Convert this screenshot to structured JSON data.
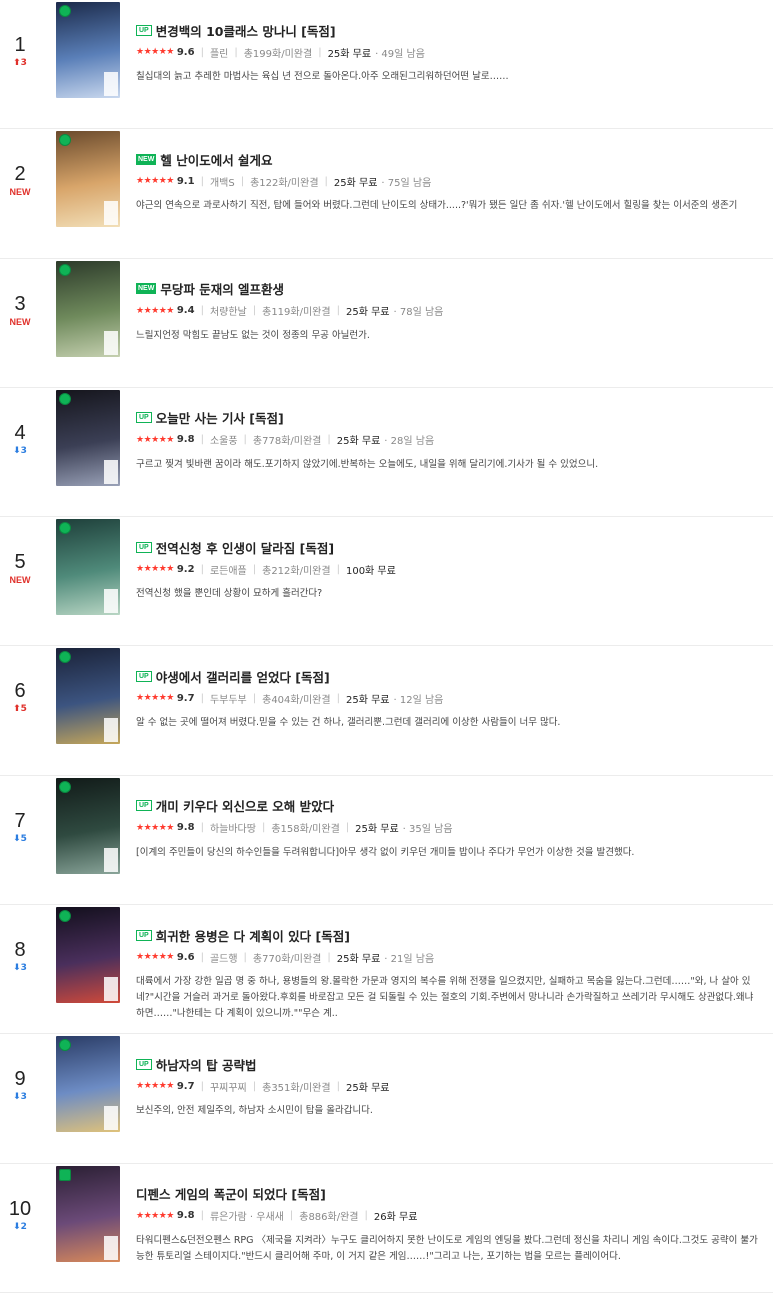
{
  "items": [
    {
      "rank": "1",
      "change": {
        "dir": "up",
        "arrow": "⬆",
        "value": "3"
      },
      "tag": "UP",
      "title": "변경백의 10클래스 망나니 [독점]",
      "stars": "★★★★★",
      "score": "9.6",
      "author": "플린",
      "episodes": "총199화/미완결",
      "free": "25화 무료",
      "days": "· 49일 남음",
      "desc": "칠십대의 늙고 추레한 마법사는 육십 년 전으로 돌아온다.아주 오래된그리워하던어떤 날로……",
      "cover": {
        "title": "",
        "colors": [
          "#1b2a4a",
          "#5a7fb8",
          "#c9d8ee"
        ]
      }
    },
    {
      "rank": "2",
      "change": {
        "dir": "new",
        "arrow": "",
        "value": "NEW"
      },
      "tag": "NEW",
      "title": "헬 난이도에서 쉴게요",
      "stars": "★★★★★",
      "score": "9.1",
      "author": "개백S",
      "episodes": "총122화/미완결",
      "free": "25화 무료",
      "days": "· 75일 남음",
      "desc": "야근의 연속으로 과로사하기 직전, 탑에 들어와 버렸다.그런데 난이도의 상태가.....?'뭐가 됐든 일단 좀 쉬자.'헬 난이도에서 힐링을 찾는 이서준의 생존기",
      "cover": {
        "title": "",
        "colors": [
          "#6a4a2c",
          "#d8a56a",
          "#f2dfb8"
        ]
      }
    },
    {
      "rank": "3",
      "change": {
        "dir": "new",
        "arrow": "",
        "value": "NEW"
      },
      "tag": "NEW",
      "title": "무당파 둔재의 엘프환생",
      "stars": "★★★★★",
      "score": "9.4",
      "author": "처량한날",
      "episodes": "총119화/미완결",
      "free": "25화 무료",
      "days": "· 78일 남음",
      "desc": "느릴지언정 막힘도 끝남도 없는 것이 정종의 무공 아닐런가.",
      "cover": {
        "title": "",
        "colors": [
          "#2c3a2a",
          "#6f8a5c",
          "#c5d0b0"
        ]
      }
    },
    {
      "rank": "4",
      "change": {
        "dir": "down",
        "arrow": "⬇",
        "value": "3"
      },
      "tag": "UP",
      "title": "오늘만 사는 기사 [독점]",
      "stars": "★★★★★",
      "score": "9.8",
      "author": "소울풍",
      "episodes": "총778화/미완결",
      "free": "25화 무료",
      "days": "· 28일 남음",
      "desc": "구르고 찢겨 빛바랜 꿈이라 해도.포기하지 않았기에.반복하는 오늘에도, 내일을 위해 달리기에.기사가 될 수 있었으니.",
      "cover": {
        "title": "",
        "colors": [
          "#15151c",
          "#3b3f55",
          "#9aa2b8"
        ]
      }
    },
    {
      "rank": "5",
      "change": {
        "dir": "new",
        "arrow": "",
        "value": "NEW"
      },
      "tag": "UP",
      "title": "전역신청 후 인생이 달라짐 [독점]",
      "stars": "★★★★★",
      "score": "9.2",
      "author": "로든애플",
      "episodes": "총212화/미완결",
      "free": "100화 무료",
      "days": "",
      "desc": "전역신청 했을 뿐인데 상황이 묘하게 흘러간다?",
      "cover": {
        "title": "",
        "colors": [
          "#1e3f3a",
          "#4f8a7a",
          "#b9d6c4"
        ]
      }
    },
    {
      "rank": "6",
      "change": {
        "dir": "up",
        "arrow": "⬆",
        "value": "5"
      },
      "tag": "UP",
      "title": "야생에서 갤러리를 얻었다 [독점]",
      "stars": "★★★★★",
      "score": "9.7",
      "author": "두부두부",
      "episodes": "총404화/미완결",
      "free": "25화 무료",
      "days": "· 12일 남음",
      "desc": "알 수 없는 곳에 떨어져 버렸다.믿을 수 있는 건 하나, 갤러리뿐.그런데 갤러리에 이상한 사람들이 너무 많다.",
      "cover": {
        "title": "",
        "colors": [
          "#1a2238",
          "#3c5480",
          "#c6a75a"
        ]
      }
    },
    {
      "rank": "7",
      "change": {
        "dir": "down",
        "arrow": "⬇",
        "value": "5"
      },
      "tag": "UP",
      "title": "개미 키우다 외신으로 오해 받았다",
      "stars": "★★★★★",
      "score": "9.8",
      "author": "하늘바다땅",
      "episodes": "총158화/미완결",
      "free": "25화 무료",
      "days": "· 35일 남음",
      "desc": "[이계의 주민들이 당신의 하수인들을 두려워합니다]아무 생각 없이 키우던 개미들 밥이나 주다가 무언가 이상한 것을 발견했다.",
      "cover": {
        "title": "",
        "colors": [
          "#111a18",
          "#2f4a40",
          "#8aa59a"
        ]
      }
    },
    {
      "rank": "8",
      "change": {
        "dir": "down",
        "arrow": "⬇",
        "value": "3"
      },
      "tag": "UP",
      "title": "희귀한 용병은 다 계획이 있다 [독점]",
      "stars": "★★★★★",
      "score": "9.6",
      "author": "골드행",
      "episodes": "총770화/미완결",
      "free": "25화 무료",
      "days": "· 21일 남음",
      "desc": "대륙에서 가장 강한 일곱 명 중 하나, 용병들의 왕.몰락한 가문과 영지의 복수를 위해 전쟁을 일으켰지만, 실패하고 목숨을 잃는다.그런데……\"와, 나 살아 있네?\"시간을 거슬러 과거로 돌아왔다.후회를 바로잡고 모든 걸 되돌릴 수 있는 절호의 기회.주변에서 망나니라 손가락질하고 쓰레기라 무시해도 상관없다.왜냐하면……\"나한테는 다 계획이 있으니까.\"\"무슨 계..",
      "cover": {
        "title": "",
        "colors": [
          "#120f1c",
          "#4a2f5c",
          "#d14a3a"
        ]
      }
    },
    {
      "rank": "9",
      "change": {
        "dir": "down",
        "arrow": "⬇",
        "value": "3"
      },
      "tag": "UP",
      "title": "하남자의 탑 공략법",
      "stars": "★★★★★",
      "score": "9.7",
      "author": "꾸찌꾸찌",
      "episodes": "총351화/미완결",
      "free": "25화 무료",
      "days": "",
      "desc": "보신주의, 안전 제일주의, 하남자 소시민이 탑을 올라갑니다.",
      "cover": {
        "title": "",
        "colors": [
          "#2a3c66",
          "#6d8cc4",
          "#e0c27a"
        ]
      }
    },
    {
      "rank": "10",
      "change": {
        "dir": "down",
        "arrow": "⬇",
        "value": "2"
      },
      "tag": "",
      "title": "디펜스 게임의 폭군이 되었다 [독점]",
      "stars": "★★★★★",
      "score": "9.8",
      "author": "류은가람 · 우새새",
      "episodes": "총886화/완결",
      "free": "26화 무료",
      "days": "",
      "desc": "타워디펜스&던전오펜스 RPG 〈제국을 지켜라〉누구도 클리어하지 못한 난이도로 게임의 엔딩을 봤다.그런데 정신을 차리니 게임 속이다.그것도 공략이 불가능한 튜토리얼 스테이지다.\"반드시 클리어해 주마, 이 거지 같은 게임……!\"그리고 나는, 포기하는 법을 모르는 플레이어다.",
      "cover": {
        "title": "",
        "colors": [
          "#2a1f33",
          "#6b4a78",
          "#d98a5a"
        ]
      }
    }
  ]
}
